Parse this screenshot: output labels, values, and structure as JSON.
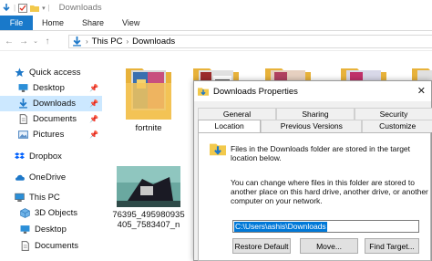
{
  "window": {
    "title": "Downloads"
  },
  "ribbon": {
    "tabs": [
      "File",
      "Home",
      "Share",
      "View"
    ]
  },
  "address": {
    "crumbs": [
      "This PC",
      "Downloads"
    ]
  },
  "navpane": {
    "items": [
      {
        "label": "Quick access",
        "icon": "star-icon"
      },
      {
        "label": "Desktop",
        "icon": "desktop-icon"
      },
      {
        "label": "Downloads",
        "icon": "download-icon"
      },
      {
        "label": "Documents",
        "icon": "documents-icon"
      },
      {
        "label": "Pictures",
        "icon": "pictures-icon"
      },
      {
        "label": "Dropbox",
        "icon": "dropbox-icon"
      },
      {
        "label": "OneDrive",
        "icon": "cloud-icon"
      },
      {
        "label": "This PC",
        "icon": "computer-icon"
      },
      {
        "label": "3D Objects",
        "icon": "cube-icon"
      },
      {
        "label": "Desktop",
        "icon": "desktop-icon"
      },
      {
        "label": "Documents",
        "icon": "documents-icon"
      }
    ]
  },
  "content": {
    "items": [
      {
        "label": "fortnite"
      },
      {
        "label_line1": "76395_495980935",
        "label_line2": "405_7583407_n"
      }
    ]
  },
  "dialog": {
    "title": "Downloads Properties",
    "tabs_row1": [
      "General",
      "Sharing",
      "Security"
    ],
    "tabs_row2": [
      "Location",
      "Previous Versions",
      "Customize"
    ],
    "info_text": "Files in the Downloads folder are stored in the target location below.",
    "info_text_line1": "Files in the Downloads folder are stored in the target",
    "info_text_line2": "location below.",
    "change_text_line1": "You can change where files in this folder are stored to",
    "change_text_line2": "another place on this hard drive, another drive, or another",
    "change_text_line3": "computer on your network.",
    "path_value": "C:\\Users\\ashis\\Downloads",
    "buttons": [
      "Restore Default",
      "Move...",
      "Find Target..."
    ]
  },
  "colors": {
    "accent": "#1979ca",
    "selection": "#cce8ff",
    "input_selection": "#0078d7"
  }
}
